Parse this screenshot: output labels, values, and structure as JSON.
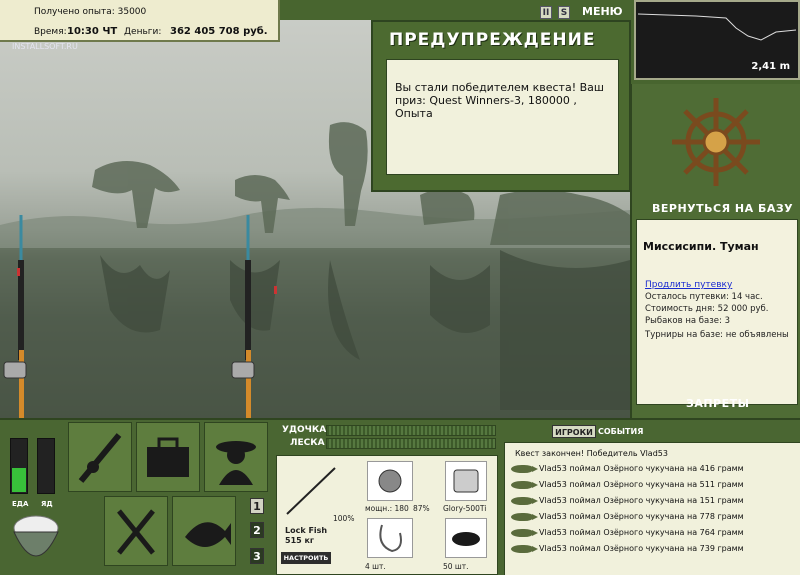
{
  "stats": {
    "xp_label": "Получено опыта:",
    "xp_value": "35000",
    "time_label": "Время:",
    "time_value": "10:30 ЧТ",
    "money_label": "Деньги:",
    "money_value": "362 405 708 руб."
  },
  "watermark": "INSTALLSOFT.RU",
  "topbar": {
    "pause_label": "II",
    "sound_label": "S",
    "menu_label": "МЕНЮ"
  },
  "warning": {
    "title": "ПРЕДУПРЕЖДЕНИЕ",
    "message": "Вы стали победителем квеста! Ваш приз: Quest Winners-3, 180000 , Опыта"
  },
  "depth": {
    "value": "2,41 m"
  },
  "base": {
    "return_label": "ВЕРНУТЬСЯ НА БАЗУ",
    "location": "Миссисипи. Туман",
    "extend_label": "Продлить путевку",
    "remaining": "Осталось путевки: 14 час.",
    "day_cost": "Стоимость дня: 52 000 руб.",
    "anglers": "Рыбаков на базе: 3",
    "tournaments": "Турниры на базе: не объявлены",
    "bans_label": "ЗАПРЕТЫ"
  },
  "status": {
    "food_label": "ЕДА",
    "poison_label": "ЯД",
    "food_level": 0.45,
    "poison_level": 0.0
  },
  "slots": [
    "1",
    "2",
    "3"
  ],
  "bars": {
    "rod_label": "УДОЧКА",
    "line_label": "ЛЕСКА"
  },
  "tackle": {
    "rod_name": "Lock Fish",
    "rod_weight": "515 кг",
    "rod_condition": "100%",
    "reel_power": "мощн.: 180",
    "reel_condition": "87%",
    "line_name": "Glory-500Ti",
    "hooks_count": "4 шт.",
    "bait_count": "50 шт.",
    "setup_label": "НАСТРОИТЬ"
  },
  "events": {
    "tab_players": "ИГРОКИ",
    "tab_events": "СОБЫТИЯ",
    "quest_done": "Квест закончен! Победитель Vlad53",
    "catches": [
      "Vlad53 поймал Озёрного чукучана на 416 грамм",
      "Vlad53 поймал Озёрного чукучана на 511 грамм",
      "Vlad53 поймал Озёрного чукучана на 151 грамм",
      "Vlad53 поймал Озёрного чукучана на 778 грамм",
      "Vlad53 поймал Озёрного чукучана на 764 грамм",
      "Vlad53 поймал Озёрного чукучана на 739 грамм"
    ]
  },
  "colors": {
    "panel_green": "#4f6c35",
    "paper": "#f1f1dc",
    "link": "#1a2bd0"
  }
}
